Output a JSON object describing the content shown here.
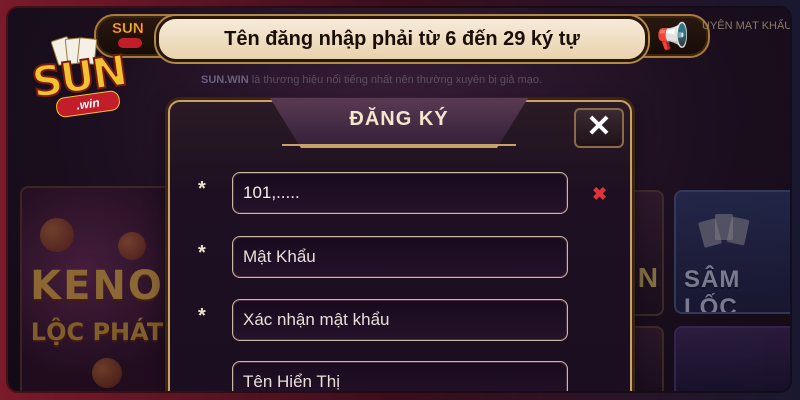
{
  "logo": {
    "brand": "SUN",
    "sub": ".win"
  },
  "banner": {
    "message": "Tên đăng nhập phải từ 6 đến 29 ký tự",
    "marquee_right": "UYÊN MẠT KHẨU"
  },
  "notice": {
    "brand": "SUN.WIN",
    "text": " là thương hiệu nổi tiếng nhất nên thường xuyên bị giả mạo."
  },
  "background_tiles": {
    "keno_title": "KENO",
    "keno_sub": "LỘC PHÁT",
    "samloc": "SÂM LỐC",
    "mid_letter": "N"
  },
  "modal": {
    "title": "ĐĂNG KÝ",
    "close_glyph": "✕",
    "required_mark": "*",
    "clear_glyph": "✖",
    "fields": [
      {
        "value": "101,.....",
        "placeholder": "",
        "required": true
      },
      {
        "value": "",
        "placeholder": "Mật Khẩu",
        "required": true
      },
      {
        "value": "",
        "placeholder": "Xác nhận mật khẩu",
        "required": true
      },
      {
        "value": "",
        "placeholder": "Tên Hiển Thị",
        "required": false
      }
    ]
  },
  "icons": {
    "speaker": "megaphone-icon",
    "close": "close-icon",
    "clear": "clear-x-icon"
  },
  "colors": {
    "accent_gold": "#c9a068",
    "clear_red": "#e0323a",
    "banner_bg": "#f6ead8"
  }
}
